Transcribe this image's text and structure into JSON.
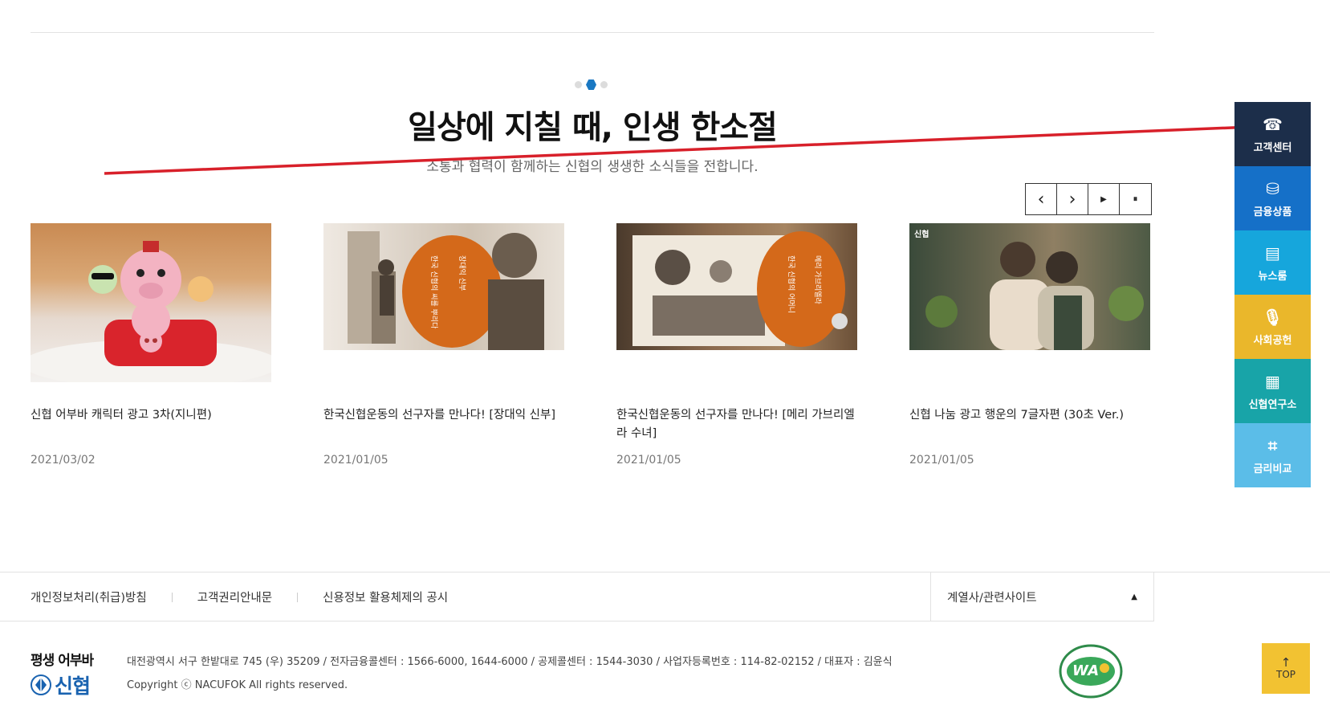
{
  "section": {
    "title": "일상에 지칠 때, 인생 한소절",
    "subtitle": "소통과 협력이 함께하는 신협의 생생한 소식들을 전합니다."
  },
  "controls": {
    "prev": "‹",
    "next": "›",
    "play": "▶",
    "pause": "⏸"
  },
  "cards": [
    {
      "title": "신협 어부바 캐릭터 광고 3차(지니편)",
      "date": "2021/03/02"
    },
    {
      "title": "한국신협운동의 선구자를 만나다! [장대익 신부]",
      "date": "2021/01/05"
    },
    {
      "title": "한국신협운동의 선구자를 만나다! [메리 가브리엘라 수녀]",
      "date": "2021/01/05"
    },
    {
      "title": "신협 나눔 광고 행운의 7글자편 (30초 Ver.)",
      "date": "2021/01/05"
    }
  ],
  "thumb_label": "신협",
  "sidebar": [
    {
      "label": "고객센터",
      "icon": "phone-icon",
      "color": "#1c2e4a"
    },
    {
      "label": "금융상품",
      "icon": "money-bag-icon",
      "color": "#1570c8"
    },
    {
      "label": "뉴스룸",
      "icon": "news-icon",
      "color": "#16a6dc"
    },
    {
      "label": "사회공헌",
      "icon": "microphone-icon",
      "color": "#eab72b"
    },
    {
      "label": "신협연구소",
      "icon": "building-icon",
      "color": "#18a4a8"
    },
    {
      "label": "금리비교",
      "icon": "chart-board-icon",
      "color": "#5bbde8"
    }
  ],
  "footer": {
    "links": [
      "개인정보처리(취급)방침",
      "고객권리안내문",
      "신용정보 활용체제의 공시"
    ],
    "family_site": "계열사/관련사이트",
    "logo_slogan": "평생 어부바",
    "logo_name": "신협",
    "info": "대전광역시 서구 한밭대로 745 (우) 35209 / 전자금융콜센터 : 1566-6000, 1644-6000 / 공제콜센터 : 1544-3030 / 사업자등록번호 : 114-82-02152 / 대표자 : 김윤식",
    "copyright": "Copyright ⓒ NACUFOK All rights reserved.",
    "wa_label": "WA",
    "top_label": "TOP"
  }
}
